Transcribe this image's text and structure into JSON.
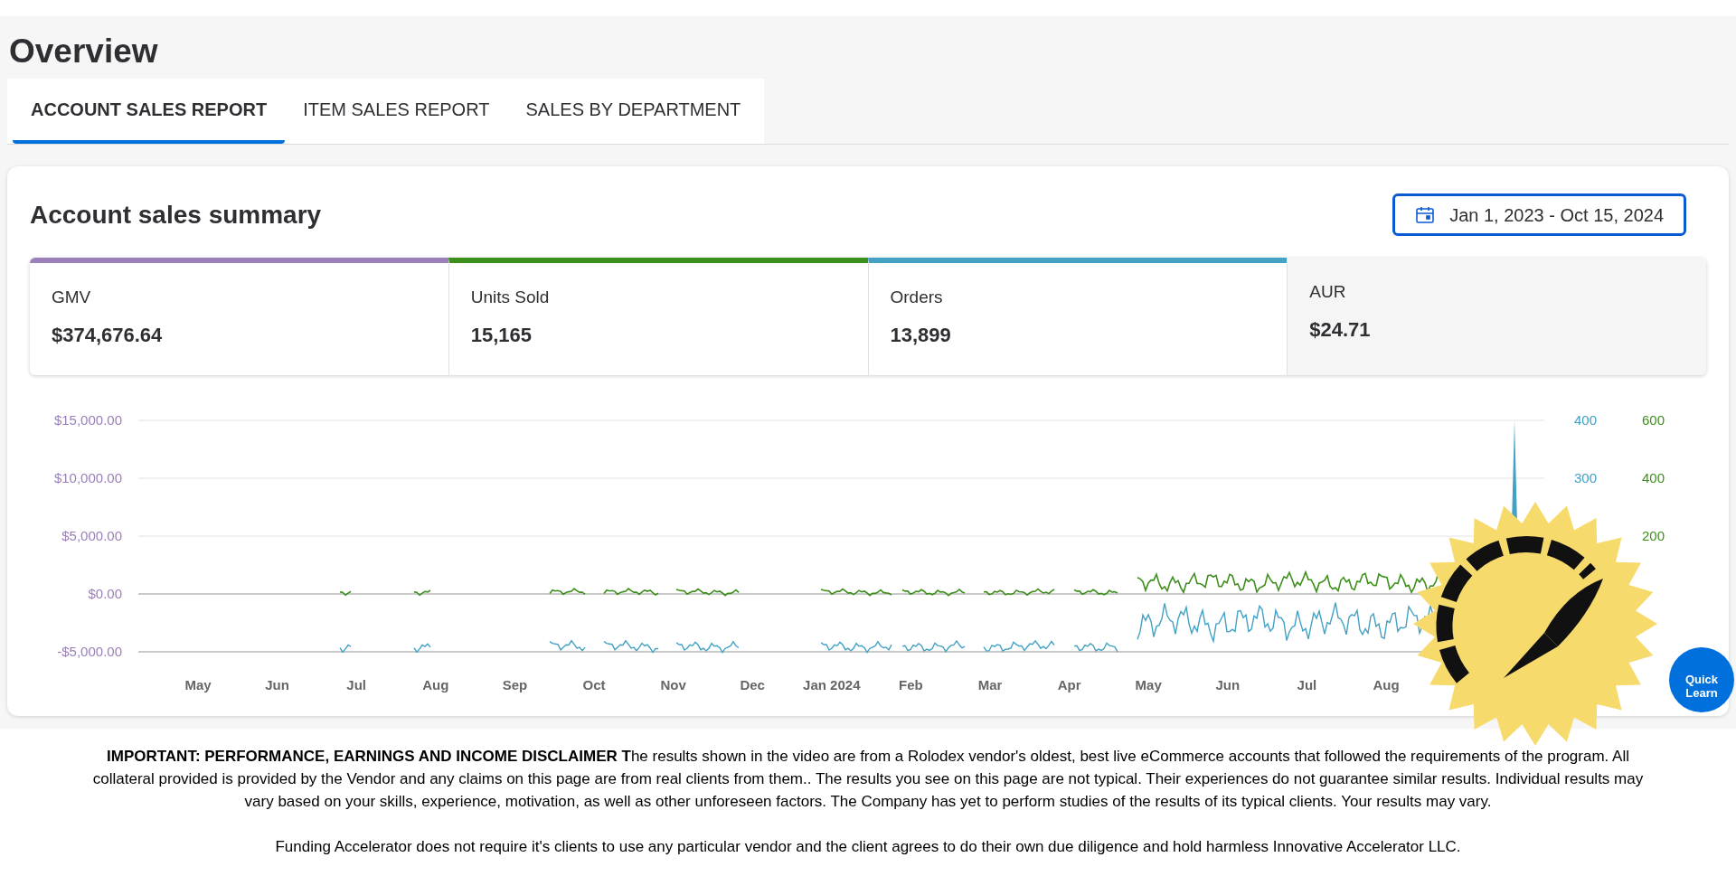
{
  "page": {
    "title": "Overview"
  },
  "tabs": [
    {
      "label": "ACCOUNT SALES REPORT",
      "selected": true
    },
    {
      "label": "ITEM SALES REPORT",
      "selected": false
    },
    {
      "label": "SALES BY DEPARTMENT",
      "selected": false
    }
  ],
  "summary": {
    "title": "Account sales summary",
    "date_range": "Jan 1, 2023 - Oct 15, 2024",
    "metrics": [
      {
        "label": "GMV",
        "value": "$374,676.64",
        "color": "#9b7fb8"
      },
      {
        "label": "Units Sold",
        "value": "15,165",
        "color": "#3d8f1c"
      },
      {
        "label": "Orders",
        "value": "13,899",
        "color": "#43a1c4"
      },
      {
        "label": "AUR",
        "value": "$24.71"
      }
    ],
    "chart": {
      "left_ticks": [
        "$15,000.00",
        "$10,000.00",
        "$5,000.00",
        "$0.00",
        "-$5,000.00"
      ],
      "right_ticks_orders": [
        "400",
        "300"
      ],
      "right_ticks_units": [
        "600",
        "400",
        "200"
      ],
      "months": [
        "May",
        "Jun",
        "Jul",
        "Aug",
        "Sep",
        "Oct",
        "Nov",
        "Dec",
        "Jan 2024",
        "Feb",
        "Mar",
        "Apr",
        "May",
        "Jun",
        "Jul",
        "Aug"
      ]
    }
  },
  "quick_learn": {
    "label": "Quick Learn"
  },
  "disclaimer": [
    "**IMPORTANT: PERFORMANCE, EARNINGS AND INCOME DISCLAIMER T**he results shown in the video are from a Rolodex vendor's oldest, best live eCommerce accounts that followed the requirements of the program. All collateral provided is provided by the Vendor and any claims on this page are from real clients from them.. The results you see on this page are not typical. Their experiences do not guarantee similar results. Individual results may vary based on your skills, experience, motivation, as well as other unforeseen factors. The Company has yet to perform studies of the results of its typical clients. Your results may vary.",
    "Funding Accelerator does not require it's clients to use any particular vendor and the client agrees to do their own due diligence and hold harmless Innovative Accelerator LLC."
  ]
}
